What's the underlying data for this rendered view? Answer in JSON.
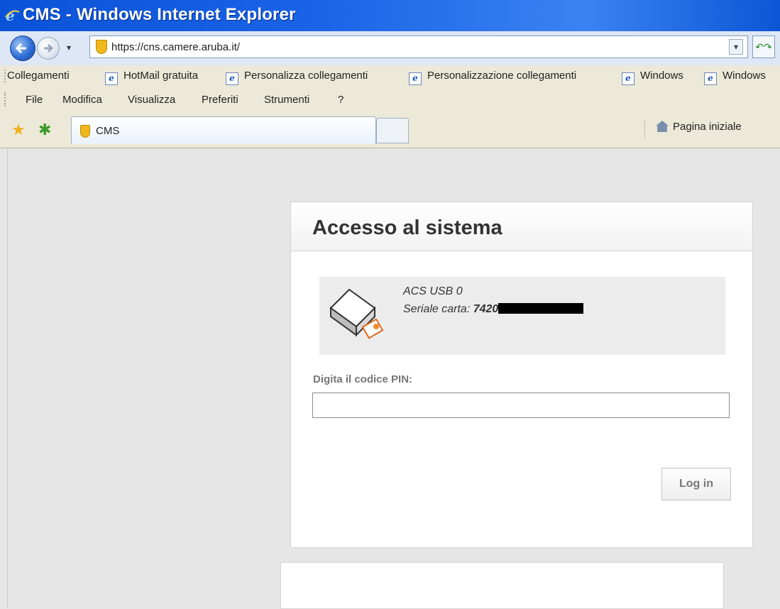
{
  "window": {
    "title": "CMS - Windows Internet Explorer"
  },
  "address_bar": {
    "url": "https://cns.camere.aruba.it/"
  },
  "links_bar": {
    "label": "Collegamenti",
    "items": [
      {
        "label": "HotMail gratuita"
      },
      {
        "label": "Personalizza collegamenti"
      },
      {
        "label": "Personalizzazione collegamenti"
      },
      {
        "label": "Windows"
      },
      {
        "label": "Windows"
      }
    ]
  },
  "menu": {
    "items": [
      "File",
      "Modifica",
      "Visualizza",
      "Preferiti",
      "Strumenti",
      "?"
    ]
  },
  "tabs": [
    {
      "label": "CMS"
    }
  ],
  "toolbar": {
    "home_label": "Pagina iniziale"
  },
  "login": {
    "title": "Accesso al sistema",
    "reader_name": "ACS USB 0",
    "serial_label": "Seriale carta:",
    "serial_value": "7420",
    "pin_label": "Digita il codice PIN:",
    "pin_value": "",
    "button_label": "Log in"
  },
  "colors": {
    "titlebar": "#0a53d8",
    "page_bg": "#e6e6e6",
    "card_bg": "#ffffff"
  }
}
